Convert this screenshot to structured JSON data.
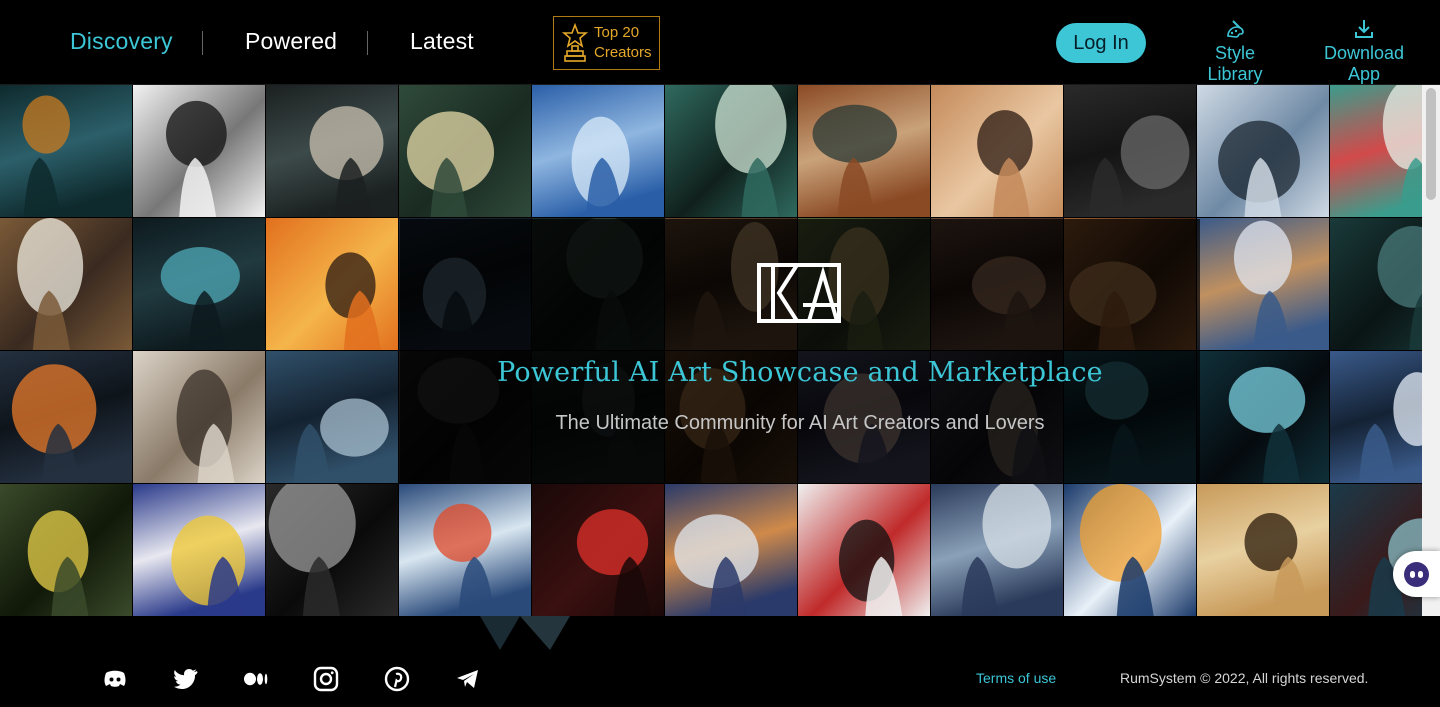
{
  "header": {
    "nav": [
      {
        "label": "Discovery",
        "active": true
      },
      {
        "label": "Powered",
        "active": false
      },
      {
        "label": "Latest",
        "active": false
      }
    ],
    "top_creators": {
      "line1": "Top 20",
      "line2": "Creators",
      "icon": "trophy-star-icon"
    },
    "login_label": "Log In",
    "style_library": {
      "label": "Style Library",
      "icon": "palette-brush-icon"
    },
    "download_app": {
      "label": "Download App",
      "icon": "download-tray-icon"
    }
  },
  "hero": {
    "title": "Powerful AI Art Showcase and Marketplace",
    "subtitle": "The Ultimate Community for AI Art Creators and Lovers",
    "logo_icon": "ka-logo-icon"
  },
  "gallery": {
    "tiles": [
      {
        "subject": "steampunk-octopus-room",
        "colors": [
          "#0e2a2d",
          "#c97a1e",
          "#2c5f6a"
        ]
      },
      {
        "subject": "manga-man-with-cat",
        "colors": [
          "#f2f2f2",
          "#111111",
          "#777777"
        ]
      },
      {
        "subject": "silver-lotus",
        "colors": [
          "#1b2020",
          "#c9c2b0",
          "#3d4a4a"
        ]
      },
      {
        "subject": "ruined-city-wanderer",
        "colors": [
          "#2f4a3a",
          "#e6d9a8",
          "#1a2b22"
        ]
      },
      {
        "subject": "anime-girl-ice",
        "colors": [
          "#2a5fa8",
          "#d8e9f8",
          "#8fb6e0"
        ]
      },
      {
        "subject": "maze-corridor-figure",
        "colors": [
          "#2f6a5f",
          "#cfe5d6",
          "#10201c"
        ]
      },
      {
        "subject": "cubist-violin",
        "colors": [
          "#8a4a24",
          "#2a3a36",
          "#c9a27a"
        ]
      },
      {
        "subject": "woman-portrait",
        "colors": [
          "#c48a5a",
          "#2b1a12",
          "#e9c7a2"
        ]
      },
      {
        "subject": "black-panther",
        "colors": [
          "#2a2a2a",
          "#6a6a6a",
          "#141414"
        ]
      },
      {
        "subject": "winter-tree",
        "colors": [
          "#cfd9e4",
          "#1b2530",
          "#6f8aa5"
        ]
      },
      {
        "subject": "cat-snarl",
        "colors": [
          "#3a9c8c",
          "#e8f0e8",
          "#d24a4a"
        ]
      },
      {
        "subject": "cartoon-cow",
        "colors": [
          "#7a5a38",
          "#f0ece0",
          "#3a2a20"
        ]
      },
      {
        "subject": "glowing-rose",
        "colors": [
          "#0d1a1e",
          "#4fa9b8",
          "#203a40"
        ]
      },
      {
        "subject": "cabin-sunset",
        "colors": [
          "#e2701e",
          "#2a1a12",
          "#f5b54a"
        ]
      },
      {
        "subject": "blue-eye",
        "colors": [
          "#1a2a3a",
          "#6a8aa0",
          "#0a1014"
        ]
      },
      {
        "subject": "dark-alley",
        "colors": [
          "#1c2a26",
          "#3a4a40",
          "#0a100e"
        ]
      },
      {
        "subject": "magician-hat",
        "colors": [
          "#6a4a30",
          "#e0b880",
          "#2a1a10"
        ]
      },
      {
        "subject": "flower-field",
        "colors": [
          "#5a6a3a",
          "#d0b070",
          "#2a3020"
        ]
      },
      {
        "subject": "warrior-bandana",
        "colors": [
          "#6a4a3a",
          "#c09070",
          "#2a1a14"
        ]
      },
      {
        "subject": "desert-road",
        "colors": [
          "#a06030",
          "#e0a060",
          "#3a2010"
        ]
      },
      {
        "subject": "geisha-porcelain",
        "colors": [
          "#3a5a8a",
          "#e0e6f0",
          "#c09060"
        ]
      },
      {
        "subject": "horned-beast",
        "colors": [
          "#1a3a3a",
          "#4a7a7a",
          "#0a1414"
        ]
      },
      {
        "subject": "night-house-car",
        "colors": [
          "#243040",
          "#e87a2a",
          "#0e141a"
        ]
      },
      {
        "subject": "white-horse",
        "colors": [
          "#dcd4c8",
          "#3a3028",
          "#8a7a68"
        ]
      },
      {
        "subject": "crystal-house",
        "colors": [
          "#30506a",
          "#a8c0d0",
          "#142230"
        ]
      },
      {
        "subject": "spooky-trees",
        "colors": [
          "#1a1a1a",
          "#3a3a3a",
          "#0a0a0a"
        ]
      },
      {
        "subject": "shadow-forest",
        "colors": [
          "#1a2020",
          "#2e3a38",
          "#0a0e0e"
        ]
      },
      {
        "subject": "tavern-table",
        "colors": [
          "#5a3a20",
          "#c08a50",
          "#241408"
        ]
      },
      {
        "subject": "party-lights",
        "colors": [
          "#4a4a6a",
          "#d0b0a0",
          "#1a1a2a"
        ]
      },
      {
        "subject": "cathedral-dusk",
        "colors": [
          "#3a3a4a",
          "#8a7a6a",
          "#14141a"
        ]
      },
      {
        "subject": "ocean-swirl",
        "colors": [
          "#1a4a5a",
          "#4aa0b0",
          "#0a1a20"
        ]
      },
      {
        "subject": "monolith-portal",
        "colors": [
          "#10303a",
          "#7ad0e0",
          "#050a0e"
        ]
      },
      {
        "subject": "frozen-lake",
        "colors": [
          "#3a5a8a",
          "#e6eef8",
          "#142234"
        ]
      },
      {
        "subject": "moon-ghoul",
        "colors": [
          "#3a4a2a",
          "#e8d04a",
          "#101808"
        ]
      },
      {
        "subject": "golden-teapot",
        "colors": [
          "#2a3a8a",
          "#f0c830",
          "#e8e8f0"
        ]
      },
      {
        "subject": "ornate-skull",
        "colors": [
          "#2a2a2a",
          "#9a9a9a",
          "#0a0a0a"
        ]
      },
      {
        "subject": "fire-ice-land",
        "colors": [
          "#2a4a7a",
          "#e04a2a",
          "#d8e6f0"
        ]
      },
      {
        "subject": "red-moon-skull",
        "colors": [
          "#1a0808",
          "#e0302a",
          "#3a1010"
        ]
      },
      {
        "subject": "winter-chapel",
        "colors": [
          "#2a3a6a",
          "#e0e8f0",
          "#d08a4a"
        ]
      },
      {
        "subject": "suit-man-rays",
        "colors": [
          "#f0f0f0",
          "#101010",
          "#c02a2a"
        ]
      },
      {
        "subject": "snow-leopard-wave",
        "colors": [
          "#2a3a5a",
          "#d8e0e8",
          "#8aa0b8"
        ]
      },
      {
        "subject": "ice-cube-sunset",
        "colors": [
          "#1a3a6a",
          "#f0a030",
          "#e8f0f8"
        ]
      },
      {
        "subject": "cheetah",
        "colors": [
          "#c89a5a",
          "#2a1a0a",
          "#e8d0a0"
        ]
      },
      {
        "subject": "cyber-warrior",
        "colors": [
          "#1a3a4a",
          "#8ac0c8",
          "#3a1a1a"
        ]
      }
    ]
  },
  "footer": {
    "social": [
      {
        "icon": "discord-icon"
      },
      {
        "icon": "twitter-icon"
      },
      {
        "icon": "medium-icon"
      },
      {
        "icon": "instagram-icon"
      },
      {
        "icon": "pinterest-icon"
      },
      {
        "icon": "telegram-icon"
      }
    ],
    "terms_label": "Terms of use",
    "copyright": "RumSystem © 2022, All rights reserved."
  },
  "chat_widget": {
    "icon": "chat-assistant-icon"
  },
  "theme": {
    "accent": "#3cc6d6",
    "gold": "#e4a72a",
    "background": "#000000"
  }
}
